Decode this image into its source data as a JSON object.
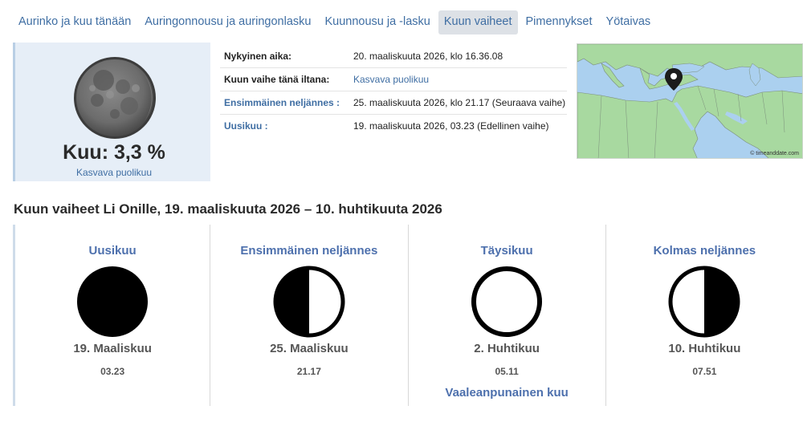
{
  "tabs": [
    {
      "label": "Aurinko ja kuu tänään",
      "active": false
    },
    {
      "label": "Auringonnousu ja auringonlasku",
      "active": false
    },
    {
      "label": "Kuunnousu ja -lasku",
      "active": false
    },
    {
      "label": "Kuun vaiheet",
      "active": true
    },
    {
      "label": "Pimennykset",
      "active": false
    },
    {
      "label": "Yötaivas",
      "active": false
    }
  ],
  "moon": {
    "illumination_text": "Kuu: 3,3 %",
    "illumination_percent": 3.3,
    "phase_label": "Kasvava puolikuu"
  },
  "info": [
    {
      "key": "Nykyinen aika:",
      "value": "20. maaliskuuta 2026, klo 16.36.08"
    },
    {
      "key": "Kuun vaihe tänä iltana:",
      "value": "Kasvava puolikuu"
    },
    {
      "key": "Ensimmäinen neljännes :",
      "value": "25. maaliskuuta 2026, klo 21.17 (Seuraava vaihe)"
    },
    {
      "key": "Uusikuu :",
      "value": "19. maaliskuuta 2026, 03.23 (Edellinen vaihe)"
    }
  ],
  "map": {
    "credit": "© timeanddate.com",
    "icon": "location-pin-icon",
    "colors": {
      "sea": "#abd0ef",
      "land": "#a8d9a0",
      "border": "#7b8f7b"
    }
  },
  "section_title": "Kuun vaiheet Li Onille, 19. maaliskuuta 2026 – 10. huhtikuuta 2026",
  "phases": [
    {
      "name": "Uusikuu",
      "date": "19. Maaliskuu",
      "time": "03.23",
      "icon": "new-moon-icon",
      "extra": ""
    },
    {
      "name": "Ensimmäinen neljännes",
      "date": "25. Maaliskuu",
      "time": "21.17",
      "icon": "first-quarter-icon",
      "extra": ""
    },
    {
      "name": "Täysikuu",
      "date": "2. Huhtikuu",
      "time": "05.11",
      "icon": "full-moon-icon",
      "extra": "Vaaleanpunainen kuu"
    },
    {
      "name": "Kolmas neljännes",
      "date": "10. Huhtikuu",
      "time": "07.51",
      "icon": "last-quarter-icon",
      "extra": ""
    }
  ],
  "colors": {
    "link": "#3f6ea3",
    "heading_link": "#4d70ad",
    "active_tab_bg": "#dde1e6",
    "moon_panel_bg": "#e6eef7"
  }
}
